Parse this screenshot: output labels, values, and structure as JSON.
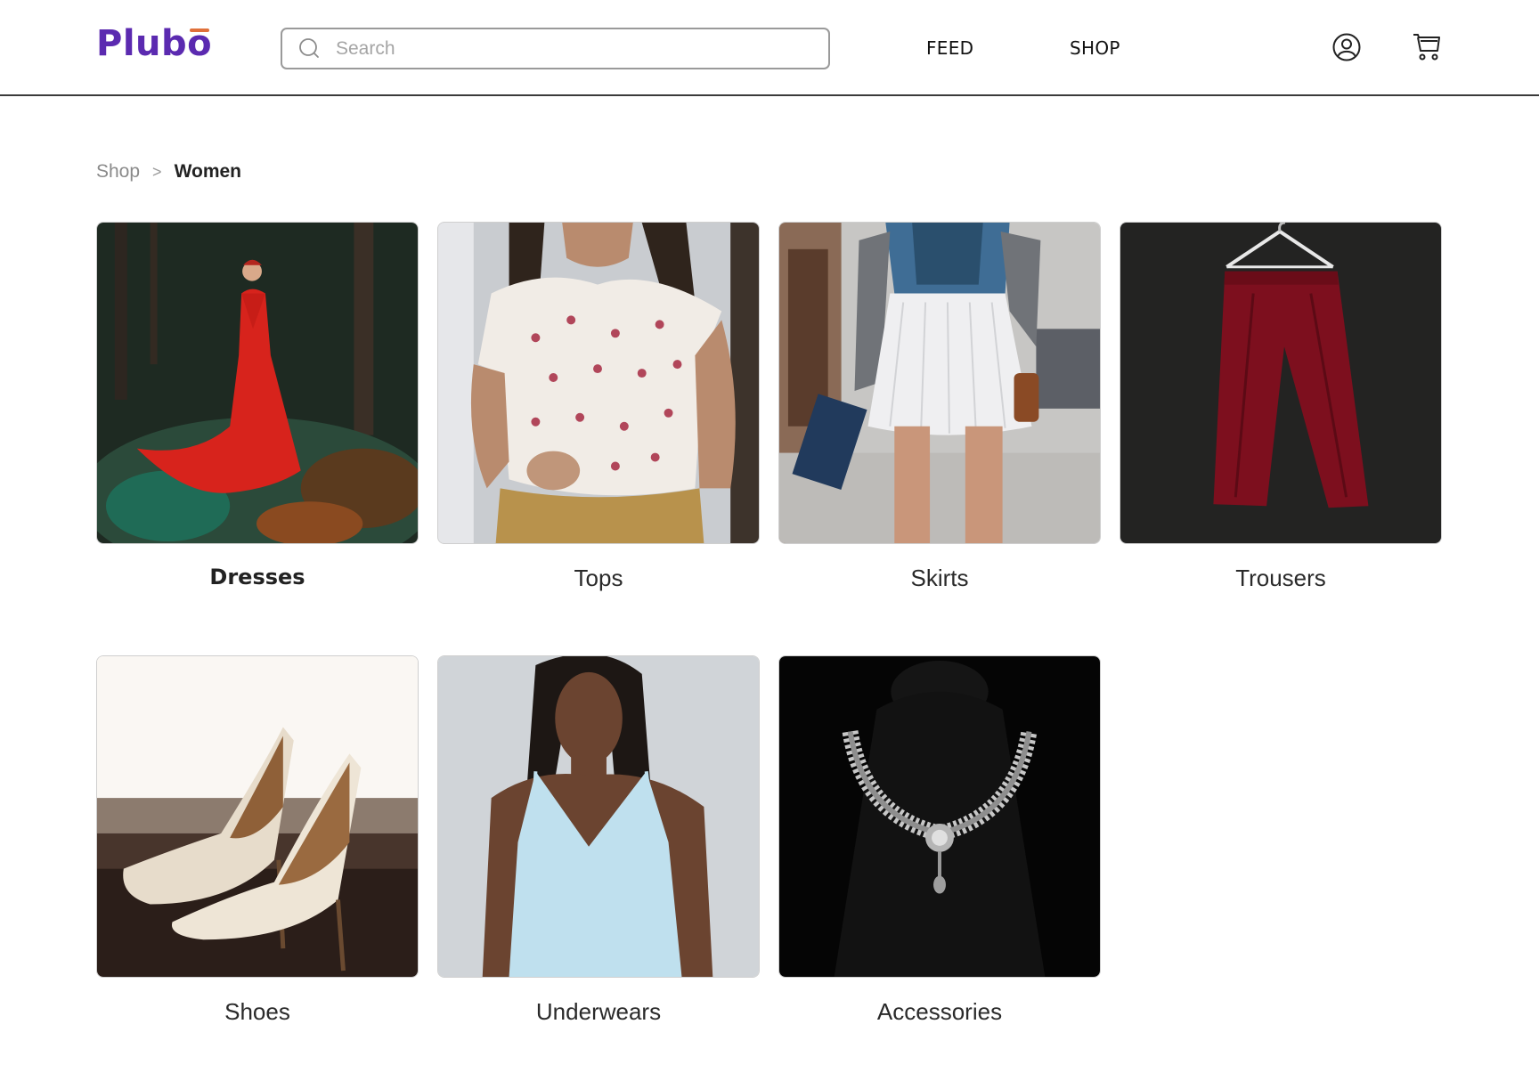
{
  "header": {
    "logo": "Plubo",
    "search": {
      "placeholder": "Search",
      "value": ""
    },
    "nav": [
      {
        "label": "FEED"
      },
      {
        "label": "SHOP"
      }
    ],
    "icons": {
      "account": "user-circle-icon",
      "cart": "shopping-cart-icon"
    }
  },
  "breadcrumb": {
    "items": [
      {
        "label": "Shop"
      },
      {
        "label": "Women"
      }
    ],
    "separator": ">"
  },
  "categories": [
    {
      "label": "Dresses"
    },
    {
      "label": "Tops"
    },
    {
      "label": "Skirts"
    },
    {
      "label": "Trousers"
    },
    {
      "label": "Shoes"
    },
    {
      "label": "Underwears"
    },
    {
      "label": "Accessories"
    }
  ],
  "colors": {
    "brand": "#5b2ab0",
    "brand_accent": "#e0703a",
    "header_border": "#3a3a3a"
  }
}
